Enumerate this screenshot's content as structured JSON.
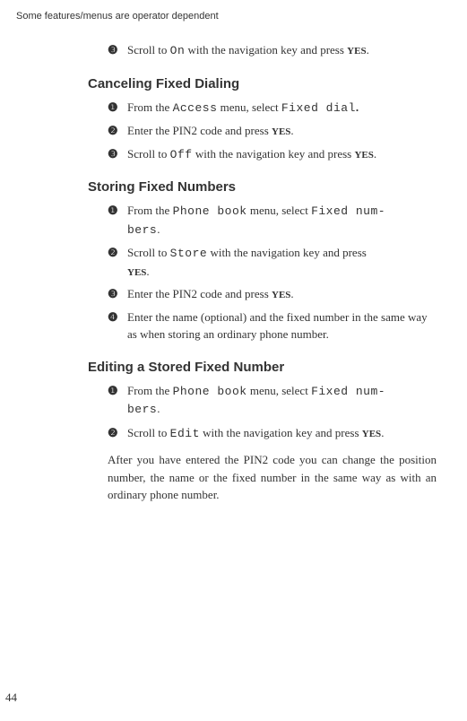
{
  "header": "Some features/menus are operator dependent",
  "intro_item": {
    "num": "❸",
    "a": "Scroll to ",
    "lcd": "On",
    "b": " with the navigation key and press ",
    "yes": "YES",
    "c": "."
  },
  "sections": [
    {
      "title": "Canceling Fixed Dialing",
      "items": [
        {
          "num": "❶",
          "a": "From the ",
          "lcd": "Access",
          "b": " menu, select ",
          "lcd2": "Fixed dial",
          "c": "."
        },
        {
          "num": "❷",
          "a": "Enter the PIN2 code and press ",
          "yes": "YES",
          "b": "."
        },
        {
          "num": "❸",
          "a": "Scroll to ",
          "lcd": "Off",
          "b": " with the navigation key and press ",
          "yes": "YES",
          "c": "."
        }
      ]
    },
    {
      "title": "Storing Fixed Numbers",
      "items": [
        {
          "num": "❶",
          "a": "From the ",
          "lcd": "Phone book",
          "b": " menu, select ",
          "lcd2": "Fixed num-",
          "lcd3": "bers",
          "c": "."
        },
        {
          "num": "❷",
          "a": "Scroll to ",
          "lcd": "Store",
          "b": " with the navigation key and press ",
          "yes": "YES",
          "c": "."
        },
        {
          "num": "❸",
          "a": "Enter the PIN2 code and press ",
          "yes": "YES",
          "b": "."
        },
        {
          "num": "❹",
          "a": "Enter the name (optional) and the fixed number in the same way as when storing an ordinary phone number."
        }
      ]
    },
    {
      "title": "Editing a Stored Fixed Number",
      "items": [
        {
          "num": "❶",
          "a": "From the ",
          "lcd": "Phone book",
          "b": " menu, select ",
          "lcd2": "Fixed num-",
          "lcd3": "bers",
          "c": "."
        },
        {
          "num": "❷",
          "a": "Scroll to ",
          "lcd": "Edit",
          "b": " with the navigation key and press ",
          "yes": "YES",
          "c": "."
        }
      ],
      "para": "After you have entered the PIN2 code you can change the position number, the name or the fixed number in the same way as with an ordinary phone number."
    }
  ],
  "page_number": "44"
}
